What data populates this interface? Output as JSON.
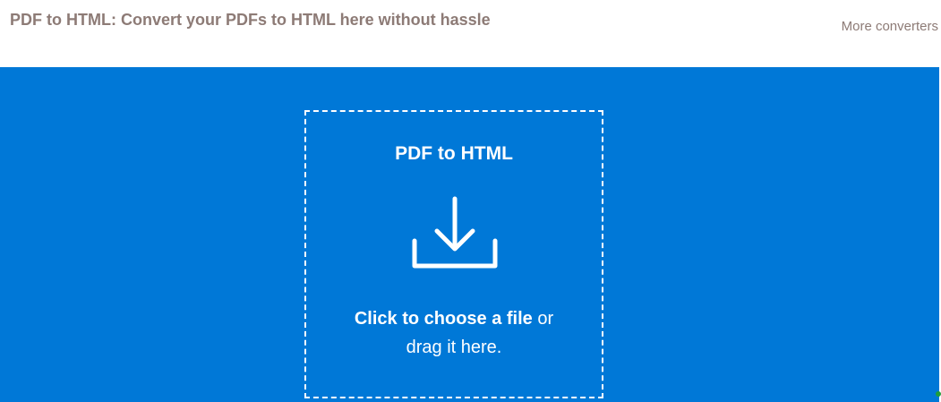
{
  "header": {
    "title": "PDF to HTML: Convert your PDFs to HTML here without hassle",
    "more_link": "More converters"
  },
  "dropzone": {
    "title": "PDF to HTML",
    "icon": "download-icon",
    "choose_label": "Click to choose a file",
    "or_text": " or",
    "drag_text": "drag it here."
  },
  "colors": {
    "accent": "#0078d7",
    "header_text": "#8d7b76",
    "dropzone_text": "#ffffff"
  }
}
